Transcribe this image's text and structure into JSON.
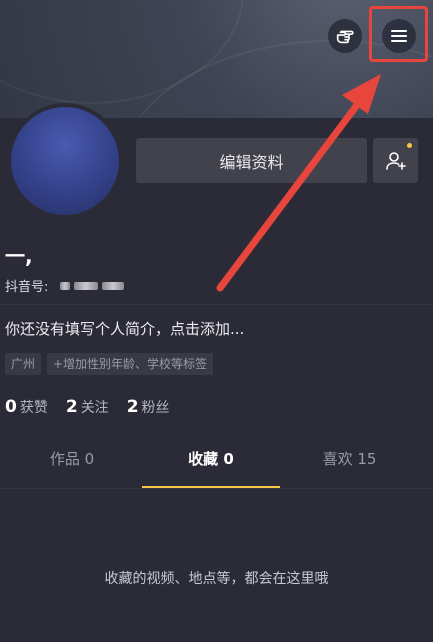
{
  "header": {
    "gesture_icon": "hand-pointing-icon",
    "menu_icon": "hamburger-menu-icon"
  },
  "annotation": {
    "color": "#e8463c"
  },
  "profile": {
    "edit_label": "编辑资料",
    "add_friend_icon": "add-friend-icon",
    "nickname": "一,",
    "id_label": "抖音号:",
    "bio": "你还没有填写个人简介，点击添加...",
    "tags": [
      "广州",
      "+增加性别年龄、学校等标签"
    ],
    "stats": [
      {
        "num": "0",
        "label": "获赞"
      },
      {
        "num": "2",
        "label": "关注"
      },
      {
        "num": "2",
        "label": "粉丝"
      }
    ]
  },
  "tabs": [
    {
      "label": "作品 0",
      "active": false
    },
    {
      "label": "收藏 0",
      "active": true
    },
    {
      "label": "喜欢 15",
      "active": false
    }
  ],
  "colors": {
    "accent": "#f5c645",
    "background": "#2b2b37"
  },
  "empty_state": "收藏的视频、地点等，都会在这里哦"
}
